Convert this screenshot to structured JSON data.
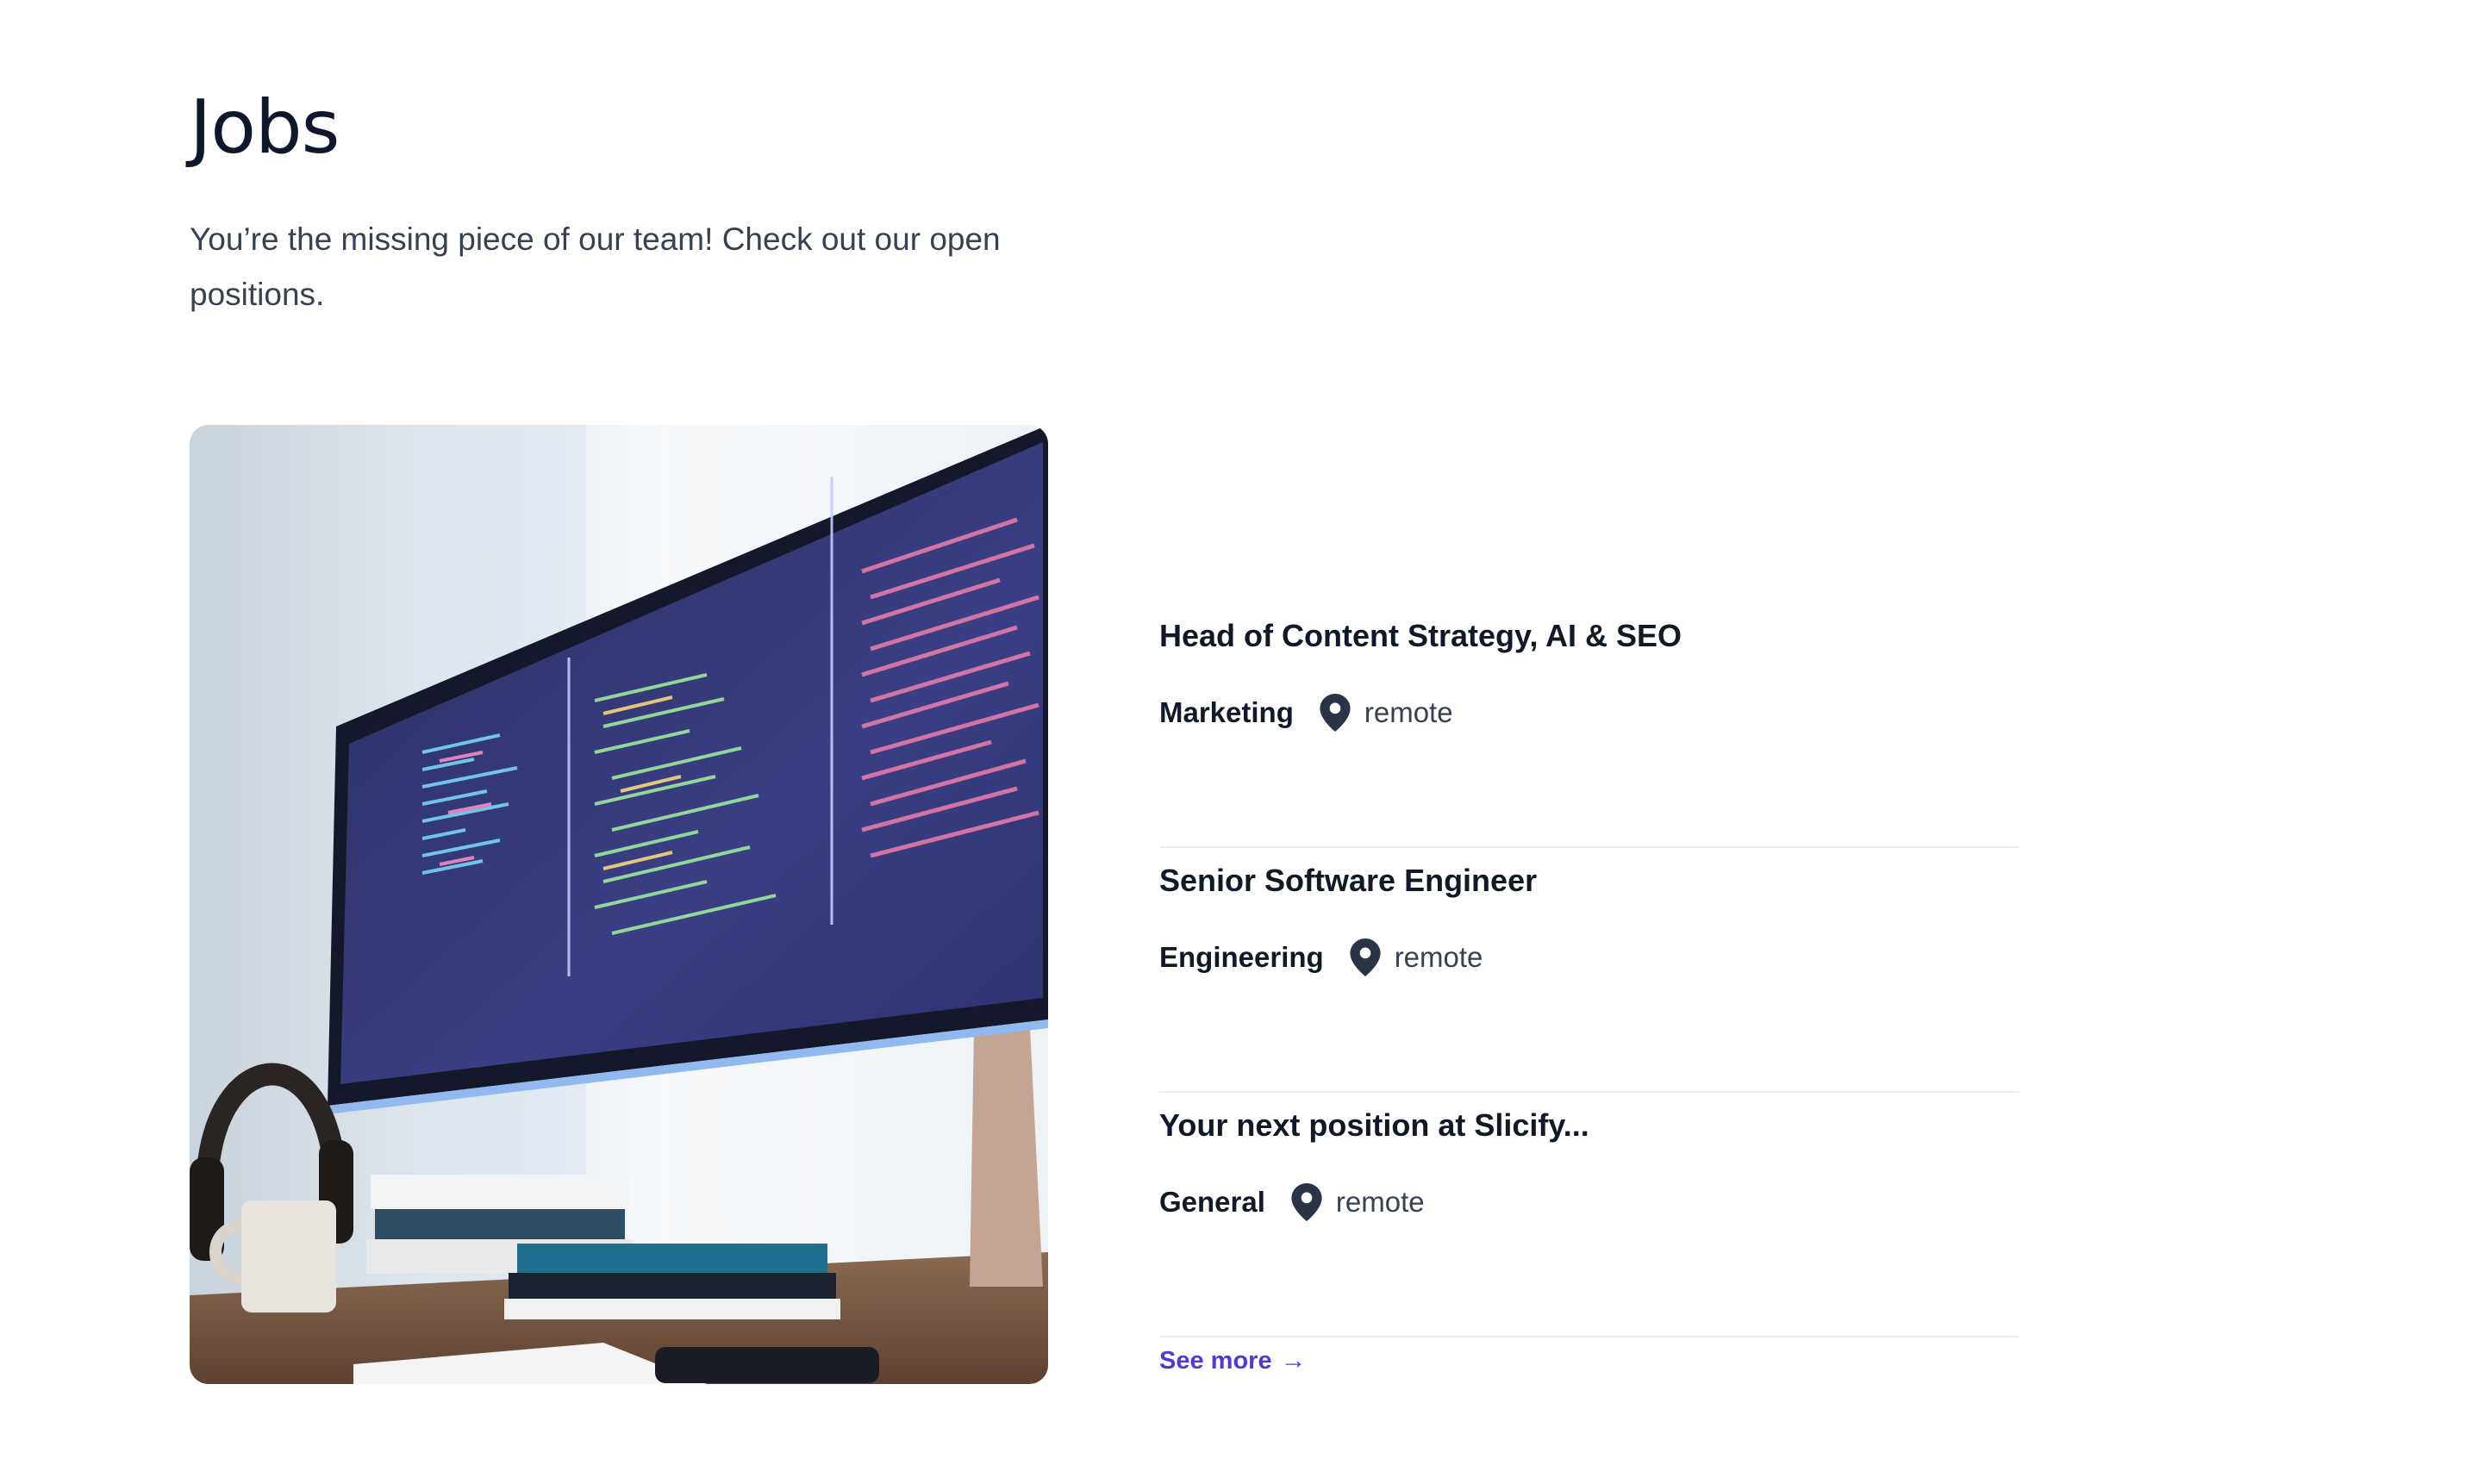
{
  "header": {
    "title": "Jobs",
    "subtitle": "You’re the missing piece of our team! Check out our open positions."
  },
  "jobs": [
    {
      "title": "Head of Content Strategy, AI & SEO",
      "department": "Marketing",
      "location": "remote"
    },
    {
      "title": "Senior Software Engineer",
      "department": "Engineering",
      "location": "remote"
    },
    {
      "title": "Your next position at Slicify...",
      "department": "General",
      "location": "remote"
    }
  ],
  "see_more": {
    "label": "See more",
    "arrow": "→"
  },
  "icons": {
    "location": "map-pin-icon",
    "arrow": "arrow-right-icon"
  },
  "colors": {
    "accent": "#4f3ad6",
    "title": "#0f172a",
    "text": "#374151",
    "divider": "#eceef2"
  }
}
